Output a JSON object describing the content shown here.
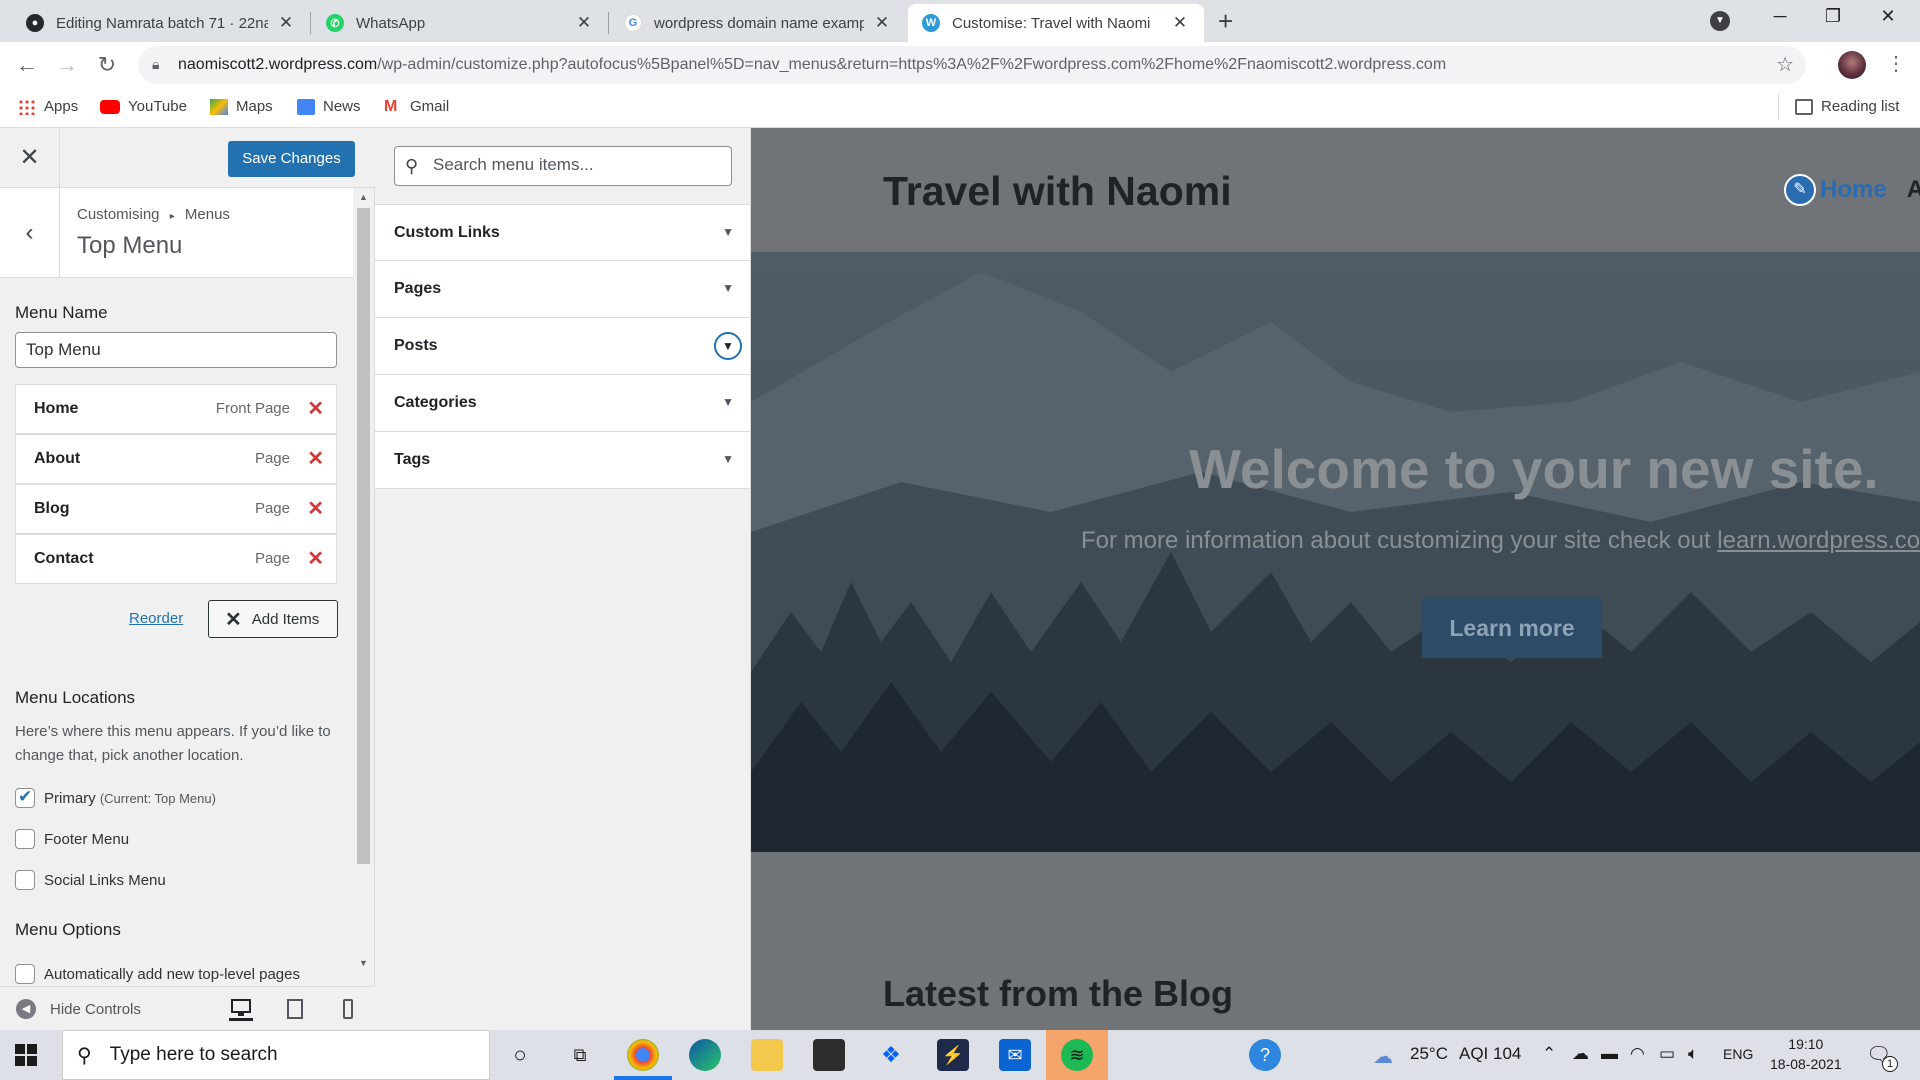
{
  "browser": {
    "tabs": [
      {
        "label": "Editing Namrata batch 71 · 22nar",
        "icon": "github-icon",
        "active": false
      },
      {
        "label": "WhatsApp",
        "icon": "whatsapp-icon",
        "active": false
      },
      {
        "label": "wordpress domain name exampl",
        "icon": "google-icon",
        "active": false
      },
      {
        "label": "Customise: Travel with Naomi",
        "icon": "wordpress-icon",
        "active": true
      }
    ],
    "new_tab": "+",
    "url_host": "naomiscott2.wordpress.com",
    "url_path": "/wp-admin/customize.php?autofocus%5Bpanel%5D=nav_menus&return=https%3A%2F%2Fwordpress.com%2Fhome%2Fnaomiscott2.wordpress.com",
    "bookmarks": [
      "Apps",
      "YouTube",
      "Maps",
      "News",
      "Gmail"
    ],
    "reading_list": "Reading list"
  },
  "customizer": {
    "save_label": "Save Changes",
    "breadcrumb_root": "Customising",
    "breadcrumb_sep": "▸",
    "breadcrumb_section": "Menus",
    "section_title": "Top Menu",
    "menu_name_label": "Menu Name",
    "menu_name_value": "Top Menu",
    "menu_items": [
      {
        "title": "Home",
        "type": "Front Page"
      },
      {
        "title": "About",
        "type": "Page"
      },
      {
        "title": "Blog",
        "type": "Page"
      },
      {
        "title": "Contact",
        "type": "Page"
      }
    ],
    "reorder_label": "Reorder",
    "add_items_label": "Add Items",
    "locations_heading": "Menu Locations",
    "locations_desc": "Here’s where this menu appears. If you’d like to change that, pick another location.",
    "locations": [
      {
        "label": "Primary",
        "note": "(Current: Top Menu)",
        "checked": true
      },
      {
        "label": "Footer Menu",
        "note": "",
        "checked": false
      },
      {
        "label": "Social Links Menu",
        "note": "",
        "checked": false
      }
    ],
    "options_heading": "Menu Options",
    "option_partial": "Automatically add new top-level pages",
    "hide_controls": "Hide Controls"
  },
  "available_items": {
    "search_placeholder": "Search menu items...",
    "sections": [
      "Custom Links",
      "Pages",
      "Posts",
      "Categories",
      "Tags"
    ]
  },
  "preview": {
    "site_title": "Travel with Naomi",
    "nav_home": "Home",
    "nav_more": "A",
    "hero_title": "Welcome to your new site.",
    "hero_sub_text": "For more information about customizing your site check out ",
    "hero_sub_link": "learn.wordpress.co",
    "hero_button": "Learn more",
    "blog_title": "Latest from the Blog"
  },
  "taskbar": {
    "search_placeholder": "Type here to search",
    "temperature": "25°C",
    "aqi": "AQI 104",
    "lang": "ENG",
    "time": "19:10",
    "date": "18-08-2021",
    "notification_count": "1"
  },
  "colors": {
    "wp_blue": "#2271b1",
    "delete_red": "#d63638",
    "chrome_tabstrip": "#dee1e6"
  }
}
